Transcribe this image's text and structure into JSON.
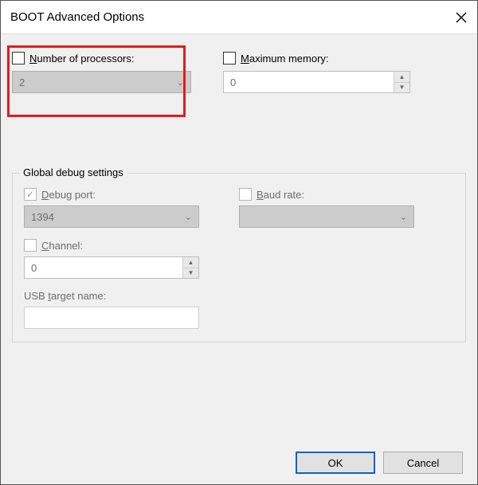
{
  "window": {
    "title": "BOOT Advanced Options"
  },
  "proc": {
    "label_pre": "N",
    "label_rest": "umber of processors:",
    "value": "2",
    "checked": false
  },
  "mem": {
    "label_pre": "M",
    "label_rest": "aximum memory:",
    "value": "0",
    "checked": false
  },
  "group": {
    "legend": "Global debug settings"
  },
  "debug_port": {
    "label_pre": "D",
    "label_rest": "ebug port:",
    "value": "1394",
    "checked": true
  },
  "baud": {
    "label_pre": "B",
    "label_rest": "aud rate:",
    "value": "",
    "checked": false
  },
  "channel": {
    "label_pre": "C",
    "label_rest": "hannel:",
    "value": "0",
    "checked": false
  },
  "usb": {
    "label_pre": "",
    "label": "USB ",
    "label_u": "t",
    "label_rest": "arget name:",
    "value": ""
  },
  "buttons": {
    "ok": "OK",
    "cancel": "Cancel"
  }
}
